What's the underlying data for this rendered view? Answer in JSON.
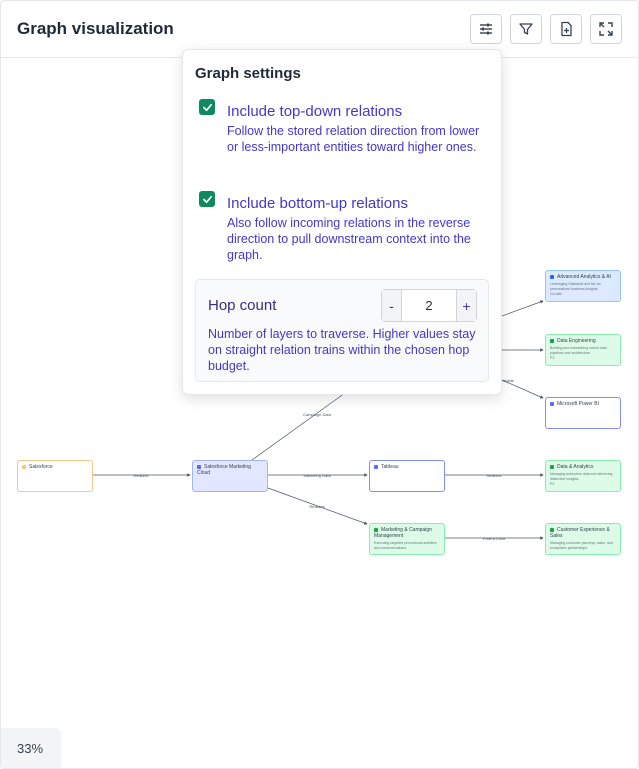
{
  "header": {
    "title": "Graph visualization",
    "buttons": [
      {
        "name": "settings-sliders-button",
        "icon": "sliders-icon"
      },
      {
        "name": "filter-button",
        "icon": "filter-icon"
      },
      {
        "name": "export-button",
        "icon": "file-plus-icon"
      },
      {
        "name": "fullscreen-button",
        "icon": "expand-icon"
      }
    ]
  },
  "zoom": {
    "level": "33%"
  },
  "settings_panel": {
    "title": "Graph settings",
    "top_down": {
      "checked": true,
      "label": "Include top-down relations",
      "description": "Follow the stored relation direction from lower or less-important entities toward higher ones."
    },
    "bottom_up": {
      "checked": true,
      "label": "Include bottom-up relations",
      "description": "Also follow incoming relations in the reverse direction to pull downstream context into the graph."
    },
    "hop_count": {
      "label": "Hop count",
      "value": "2",
      "minus_label": "-",
      "plus_label": "+",
      "description": "Number of layers to traverse. Higher values stay on straight relation trains within the chosen hop budget."
    }
  },
  "graph": {
    "nodes": {
      "salesforce": {
        "title": "Salesforce",
        "desc": ""
      },
      "sfmc": {
        "title": "Salesforce Marketing Cloud",
        "desc": ""
      },
      "tableau": {
        "title": "Tableau",
        "desc": ""
      },
      "mcm": {
        "title": "Marketing & Campaign Management",
        "desc": "Executing targeted promotional activities and communications."
      },
      "aai": {
        "title": "Advanced Analytics & AI",
        "desc": "Leveraging Statistical and ML for personalized business insights.",
        "badge": "Go with"
      },
      "de": {
        "title": "Data Engineering",
        "desc": "Building and maintaining robust data pipelines and architecture.",
        "badge": "P3"
      },
      "pbi": {
        "title": "Microsoft Power BI",
        "desc": ""
      },
      "da": {
        "title": "Data & Analytics",
        "desc": "Managing enterprise data and delivering distinctive insights.",
        "badge": "P3"
      },
      "cxs": {
        "title": "Customer Experience & Sales",
        "desc": "Managing customer journeys, sales, and ecosystem partnerships."
      }
    },
    "edge_labels": {
      "sf_sfmc": "Realizes",
      "sfmc_tableau": "Marketing Data",
      "sfmc_mcm": "Realizes",
      "sfmc_up": "Campaign Data",
      "tableau_da": "Realizes",
      "mcm_cxs": "Parent-Child",
      "to_pbi": "Insights"
    }
  }
}
